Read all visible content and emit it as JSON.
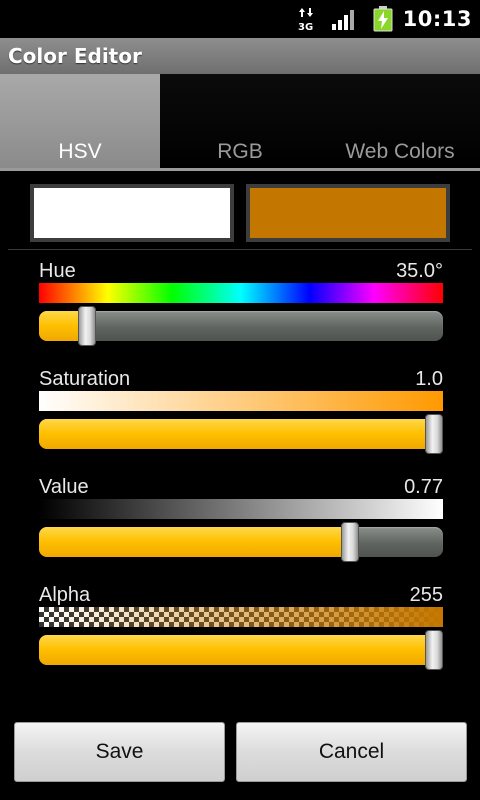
{
  "status_bar": {
    "network_label": "3G",
    "time": "10:13",
    "icons": [
      "3g-data-icon",
      "signal-icon",
      "battery-charging-icon"
    ]
  },
  "title_bar": {
    "title": "Color Editor"
  },
  "tabs": [
    {
      "label": "HSV",
      "active": true
    },
    {
      "label": "RGB",
      "active": false
    },
    {
      "label": "Web Colors",
      "active": false
    }
  ],
  "swatches": {
    "old_color": "#ffffff",
    "new_color": "#c47700"
  },
  "sliders": {
    "hue": {
      "label": "Hue",
      "value": "35.0°",
      "fill_fraction": 0.12
    },
    "saturation": {
      "label": "Saturation",
      "value": "1.0",
      "fill_fraction": 1.0
    },
    "value": {
      "label": "Value",
      "value": "0.77",
      "fill_fraction": 0.77
    },
    "alpha": {
      "label": "Alpha",
      "value": "255",
      "fill_fraction": 1.0
    }
  },
  "buttons": {
    "save": "Save",
    "cancel": "Cancel"
  },
  "colors": {
    "accent": "#ffbf00",
    "title_bar": "#7e7e7e"
  }
}
